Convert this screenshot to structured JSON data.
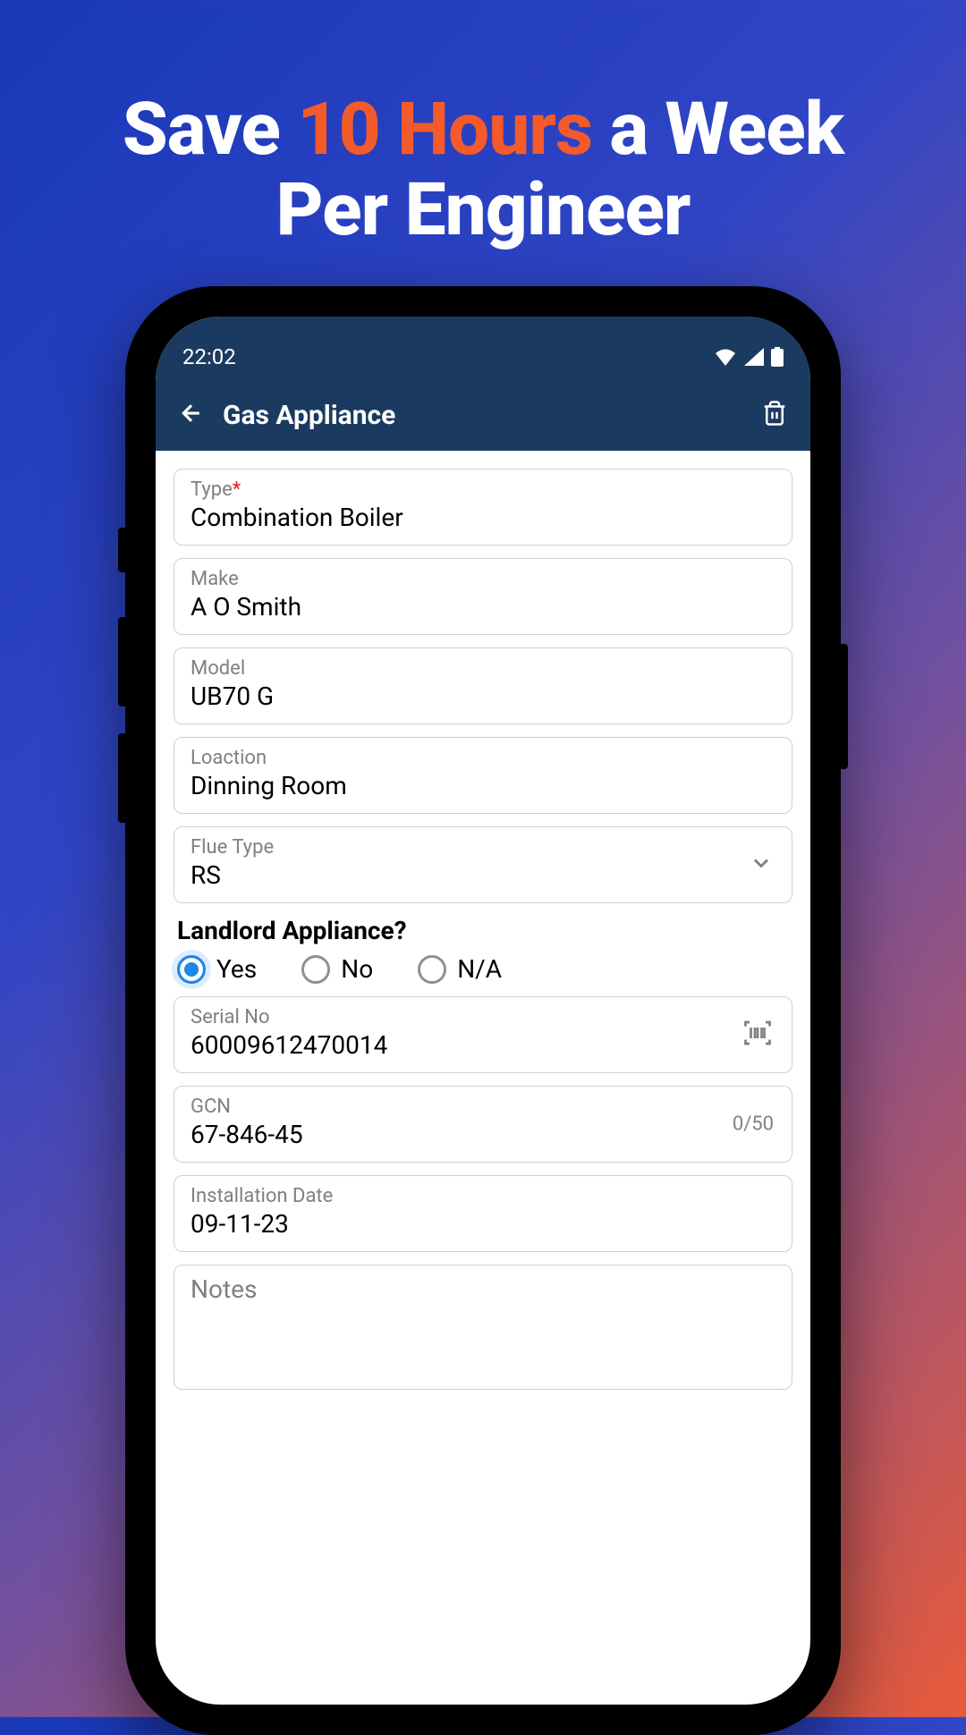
{
  "headline": {
    "part1": "Save ",
    "highlight": "10 Hours",
    "part2": " a Week",
    "line2": "Per Engineer"
  },
  "statusBar": {
    "time": "22:02"
  },
  "header": {
    "title": "Gas Appliance"
  },
  "fields": {
    "type": {
      "label": "Type",
      "value": "Combination Boiler",
      "required": true
    },
    "make": {
      "label": "Make",
      "value": "A O Smith"
    },
    "model": {
      "label": "Model",
      "value": "UB70 G"
    },
    "location": {
      "label": "Loaction",
      "value": "Dinning Room"
    },
    "flueType": {
      "label": "Flue Type",
      "value": "RS"
    },
    "serialNo": {
      "label": "Serial No",
      "value": "60009612470014"
    },
    "gcn": {
      "label": "GCN",
      "value": "67-846-45",
      "counter": "0/50"
    },
    "installDate": {
      "label": "Installation Date",
      "value": "09-11-23"
    },
    "notes": {
      "label": "Notes"
    }
  },
  "landlordQuestion": {
    "label": "Landlord Appliance?",
    "options": [
      {
        "label": "Yes",
        "checked": true
      },
      {
        "label": "No",
        "checked": false
      },
      {
        "label": "N/A",
        "checked": false
      }
    ]
  }
}
